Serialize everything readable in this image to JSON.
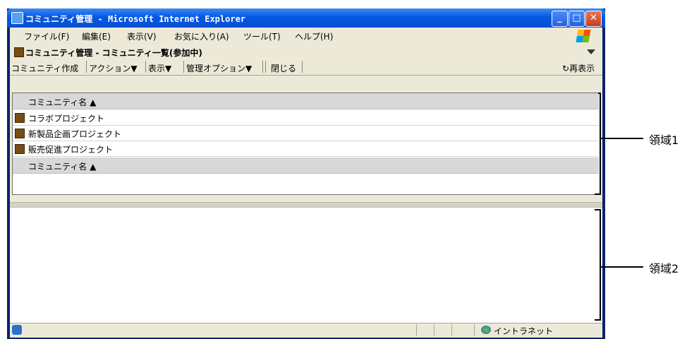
{
  "window": {
    "title": "コミュニティ管理 - Microsoft Internet Explorer",
    "controls": [
      "_",
      "□",
      "✕"
    ]
  },
  "menubar": {
    "items": [
      "ファイル(F)",
      "編集(E)",
      "表示(V)",
      "お気に入り(A)",
      "ツール(T)",
      "ヘルプ(H)"
    ]
  },
  "panel": {
    "title": "コミュニティ管理 - コミュニティ一覧(参加中)"
  },
  "toolbar": {
    "items": [
      "コミュニティ作成",
      "アクション▼",
      "表示▼",
      "管理オプション▼",
      "閉じる"
    ],
    "refresh": "再表示"
  },
  "region1": {
    "column_header": "コミュニティ名 ▲",
    "rows": [
      "コラボプロジェクト",
      "新製品企画プロジェクト",
      "販売促進プロジェクト"
    ],
    "footer_header": "コミュニティ名 ▲"
  },
  "statusbar": {
    "zone": "イントラネット"
  },
  "callouts": {
    "region1": "領域1",
    "region2": "領域2"
  },
  "icons": {
    "ie": "ie-page-icon",
    "community": "community-icon",
    "refresh": "refresh-icon",
    "windows_flag": "windows-flag-icon"
  }
}
